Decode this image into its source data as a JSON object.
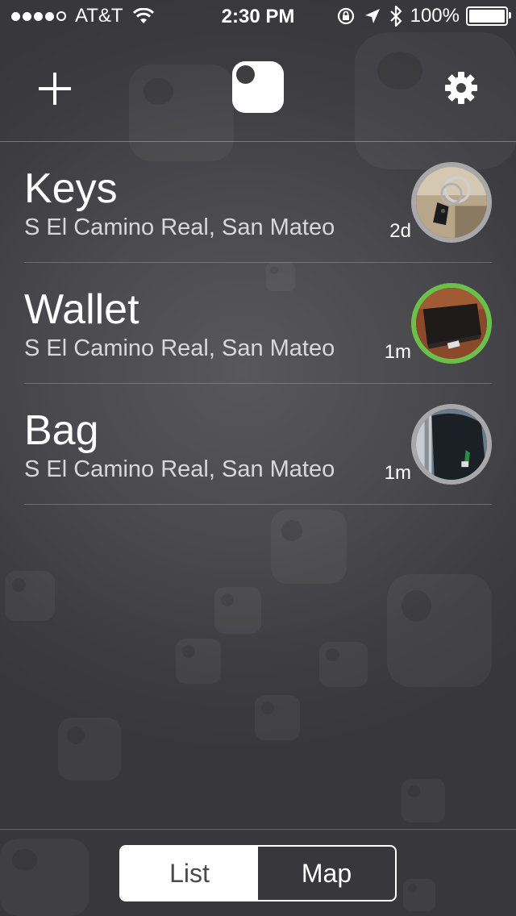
{
  "status_bar": {
    "carrier": "AT&T",
    "signal_bars_filled": 4,
    "signal_bars_total": 5,
    "time": "2:30 PM",
    "battery_text": "100%",
    "battery_level": 1.0
  },
  "nav": {
    "add_icon": "plus-icon",
    "logo_icon": "tile-logo-icon",
    "settings_icon": "gear-icon"
  },
  "items": [
    {
      "name": "Keys",
      "location": "S El Camino Real, San Mateo",
      "time_ago": "2d",
      "status_color": "#a8a8aa",
      "active": false
    },
    {
      "name": "Wallet",
      "location": "S El Camino Real, San Mateo",
      "time_ago": "1m",
      "status_color": "#6cc04a",
      "active": true
    },
    {
      "name": "Bag",
      "location": "S El Camino Real, San Mateo",
      "time_ago": "1m",
      "status_color": "#a8a8aa",
      "active": false
    }
  ],
  "view_toggle": {
    "list_label": "List",
    "map_label": "Map",
    "selected": "List"
  },
  "colors": {
    "accent_active": "#6cc04a",
    "ring_inactive": "#a8a8aa",
    "background": "#4a4a4e"
  }
}
